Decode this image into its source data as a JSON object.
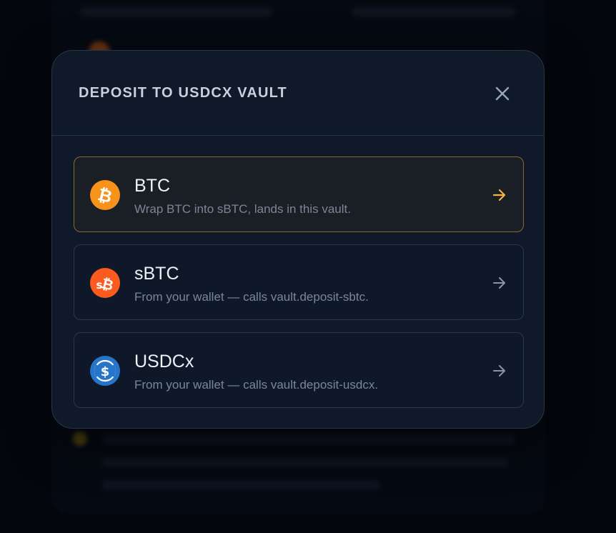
{
  "modal": {
    "title": "DEPOSIT TO USDCX VAULT",
    "close_icon": "close-icon"
  },
  "options": [
    {
      "label": "BTC",
      "description": "Wrap BTC into sBTC, lands in this vault.",
      "icon": "bitcoin-icon",
      "icon_color": "#f7931a",
      "selected": true,
      "arrow_color": "#f5b342"
    },
    {
      "label": "sBTC",
      "description": "From your wallet — calls vault.deposit-sbtc.",
      "icon": "sbtc-icon",
      "icon_color": "#fc5b1f",
      "selected": false,
      "arrow_color": "#8a94a6"
    },
    {
      "label": "USDCx",
      "description": "From your wallet — calls vault.deposit-usdcx.",
      "icon": "usdc-icon",
      "icon_color": "#2775ca",
      "selected": false,
      "arrow_color": "#8a94a6"
    }
  ],
  "colors": {
    "modal_bg": "#0f192a",
    "selected_border": "#8a6a2c",
    "accent": "#f5b342"
  }
}
